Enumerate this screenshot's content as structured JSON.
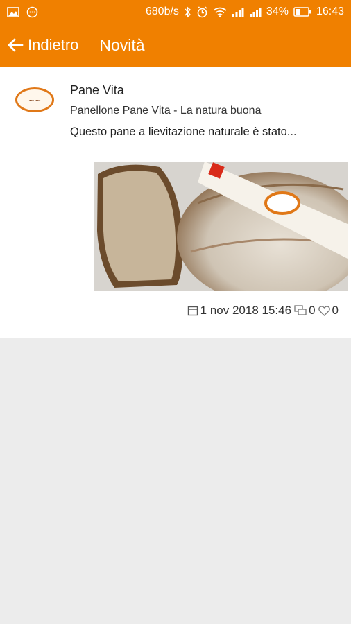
{
  "status_bar": {
    "network_speed": "680b/s",
    "battery_percent": "34%",
    "time": "16:43",
    "icons": [
      "image-icon",
      "messaging-icon",
      "bluetooth-icon",
      "alarm-icon",
      "wifi-icon",
      "signal-icon",
      "signal-icon",
      "battery-icon"
    ]
  },
  "app_bar": {
    "back_label": "Indietro",
    "title": "Novità",
    "color": "#f08000"
  },
  "post": {
    "author": "Pane Vita",
    "title": "Panellone Pane Vita - La natura buona",
    "excerpt": "Questo pane a lievitazione naturale è stato...",
    "image_alt": "bread-photo",
    "date": "1 nov 2018 15:46",
    "comments": "0",
    "likes": "0"
  }
}
